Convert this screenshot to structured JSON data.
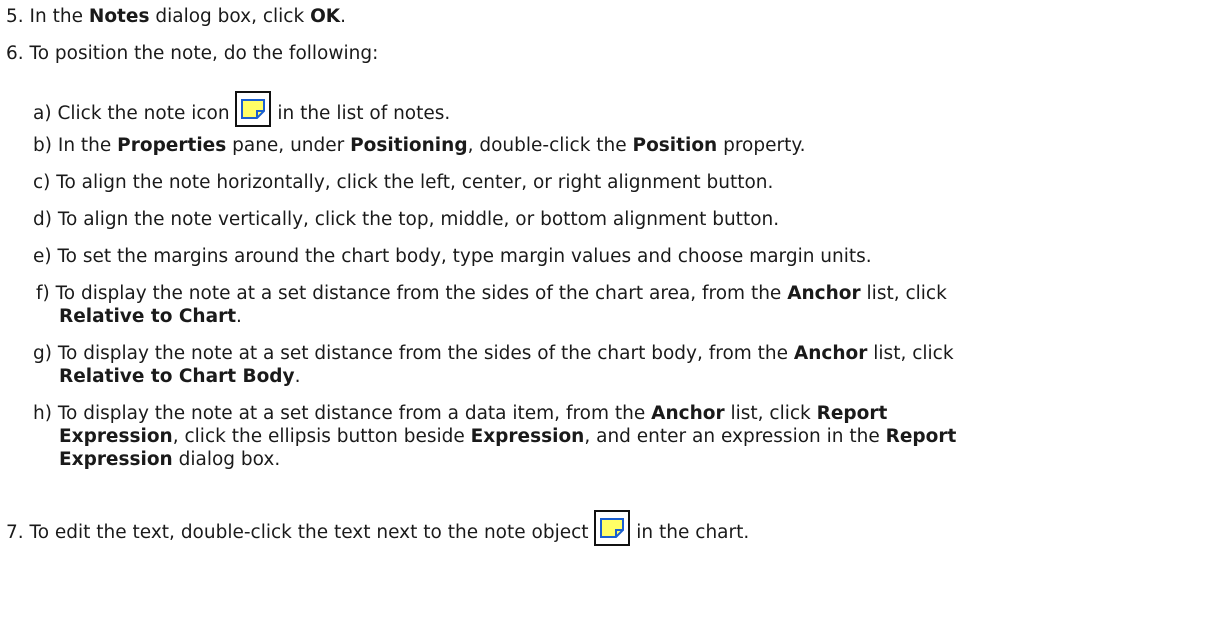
{
  "steps": {
    "s5": {
      "num": "5.",
      "pre": "In the ",
      "b1": "Notes",
      "mid": " dialog box, click ",
      "b2": "OK",
      "post": "."
    },
    "s6": {
      "num": "6.",
      "text": "To position the note, do the following:"
    },
    "a": {
      "letter": "a)",
      "pre": "Click the note icon ",
      "post": " in the list of notes."
    },
    "b": {
      "letter": "b)",
      "p1": "In the ",
      "b1": "Properties",
      "p2": " pane, under ",
      "b2": "Positioning",
      "p3": ", double-click the ",
      "b3": "Position",
      "p4": " property."
    },
    "c": {
      "letter": "c)",
      "text": "To align the note horizontally, click the left, center, or right alignment button."
    },
    "d": {
      "letter": "d)",
      "text": "To align the note vertically, click the top, middle, or bottom alignment button."
    },
    "e": {
      "letter": "e)",
      "text": "To set the margins around the chart body, type margin values and choose margin units."
    },
    "f": {
      "letter": "f)",
      "p1": "To display the note at a set distance from the sides of the chart area, from the ",
      "b1": "Anchor",
      "p2": " list, click",
      "b2": "Relative to Chart",
      "p3": "."
    },
    "g": {
      "letter": "g)",
      "p1": "To display the note at a set distance from the sides of the chart body, from the ",
      "b1": "Anchor",
      "p2": " list, click",
      "b2": "Relative to Chart Body",
      "p3": "."
    },
    "h": {
      "letter": "h)",
      "p1": "To display the note at a set distance from a data item, from the ",
      "b1": "Anchor",
      "p2": " list, click ",
      "b2": "Report",
      "b3": "Expression",
      "p3": ", click the ellipsis button beside ",
      "b4": "Expression",
      "p4": ", and enter an expression in the ",
      "b5": "Report",
      "b6": "Expression",
      "p5": " dialog box."
    },
    "s7": {
      "num": "7.",
      "pre": "To edit the text, double-click the text next to the note object ",
      "post": " in the chart."
    }
  },
  "icons": {
    "note": "note-icon"
  },
  "colors": {
    "note_fill": "#ffff66",
    "note_stroke": "#1a5fd0"
  }
}
